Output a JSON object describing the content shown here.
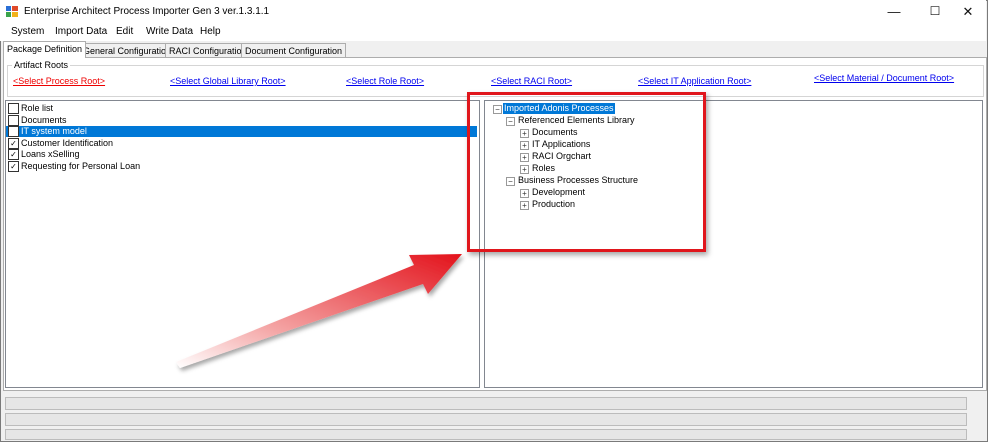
{
  "window": {
    "title": "Enterprise Architect Process Importer Gen 3 ver.1.3.1.1",
    "controls": {
      "minimize": "—",
      "maximize": "☐",
      "close": "✕"
    }
  },
  "menu": [
    "System",
    "Import Data",
    "Edit",
    "Write Data",
    "Help"
  ],
  "tabs": [
    "Package Definition",
    "General Configuration",
    "RACI Configuration",
    "Document Configuration"
  ],
  "active_tab": "Package Definition",
  "artifact_roots": {
    "label": "Artifact Roots",
    "links": [
      "<Select Process Root>",
      "<Select Global Library Root>",
      "<Select Role Root>",
      "<Select RACI Root>",
      "<Select IT Application Root>",
      "<Select Material / Document Root>"
    ]
  },
  "package_list": [
    {
      "label": "Role list",
      "checked": false,
      "selected": false
    },
    {
      "label": "Documents",
      "checked": false,
      "selected": false
    },
    {
      "label": "IT system model",
      "checked": false,
      "selected": true
    },
    {
      "label": "Customer Identification",
      "checked": true,
      "selected": false
    },
    {
      "label": "Loans xSelling",
      "checked": true,
      "selected": false
    },
    {
      "label": "Requesting for Personal Loan",
      "checked": true,
      "selected": false
    }
  ],
  "tree": {
    "root": "Imported Adonis Processes",
    "referenced": "Referenced Elements Library",
    "ref_children": [
      "Documents",
      "IT Applications",
      "RACI Orgchart",
      "Roles"
    ],
    "business": "Business Processes Structure",
    "bps_children": [
      "Development",
      "Production"
    ]
  },
  "colors": {
    "selection": "#0078d7",
    "annotation": "#e0161c",
    "link": "#0000ee",
    "link_active": "#ee0000"
  }
}
